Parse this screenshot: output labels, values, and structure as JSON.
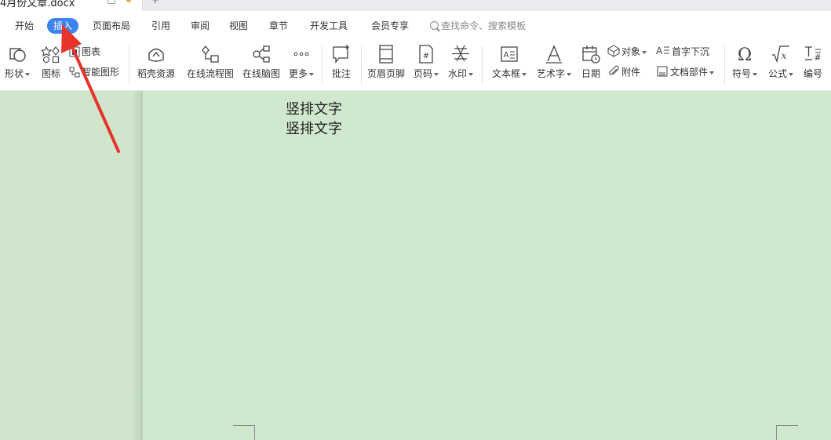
{
  "tab": {
    "title": "4月份文章.docx",
    "new_tab": "+"
  },
  "menu": {
    "start": "开始",
    "insert": "插入",
    "page_layout": "页面布局",
    "references": "引用",
    "review": "审阅",
    "view": "视图",
    "section": "章节",
    "dev_tools": "开发工具",
    "member": "会员专享",
    "search_placeholder": "查找命令、搜索模板"
  },
  "ribbon": {
    "shape": "形状",
    "icon": "图标",
    "chart": "图表",
    "smart_art": "智能图形",
    "docer": "稻壳资源",
    "flowchart": "在线流程图",
    "mindmap": "在线脑图",
    "more": "更多",
    "comment": "批注",
    "header_footer": "页眉页脚",
    "page_number": "页码",
    "watermark": "水印",
    "text_box": "文本框",
    "word_art": "艺术字",
    "date": "日期",
    "object": "对象",
    "attachment": "附件",
    "drop_cap": "首字下沉",
    "doc_parts": "文档部件",
    "symbol": "符号",
    "formula": "公式",
    "numbering": "编号"
  },
  "document": {
    "lines": [
      "竖排文字",
      "竖排文字"
    ]
  },
  "colors": {
    "accent": "#3d84f0",
    "page_bg": "#d0e8cd",
    "arrow": "#e8332b"
  }
}
